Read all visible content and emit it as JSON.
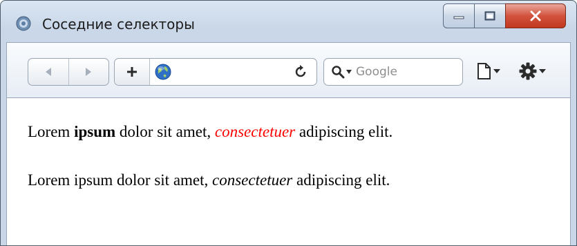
{
  "window": {
    "title": "Соседние селекторы"
  },
  "toolbar": {
    "search_placeholder": "Google",
    "icons": [
      "back-arrow-icon",
      "forward-arrow-icon",
      "plus-icon",
      "globe-icon",
      "reload-icon",
      "search-icon",
      "page-icon",
      "gear-icon"
    ]
  },
  "content": {
    "paragraph1": {
      "segments": [
        "Lorem ",
        "ipsum",
        " dolor sit amet, ",
        "consectetuer",
        " adipiscing elit."
      ]
    },
    "paragraph2": {
      "segments": [
        "Lorem ipsum dolor sit amet, ",
        "consectetuer",
        " adipiscing elit."
      ]
    }
  },
  "colors": {
    "highlight": "#ff0000",
    "text": "#000000",
    "close_button": "#c8452d"
  }
}
